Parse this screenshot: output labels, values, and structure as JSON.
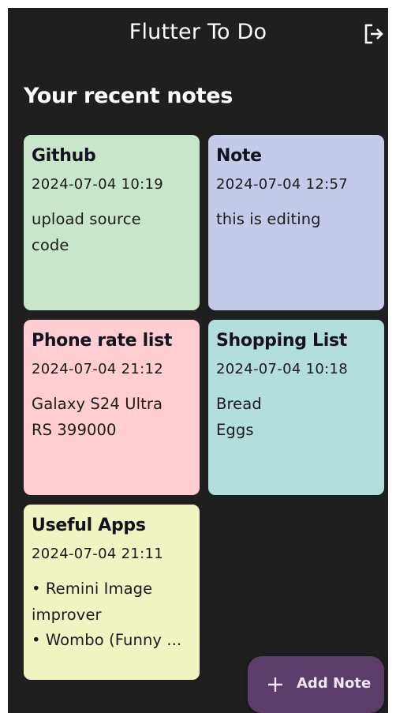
{
  "appbar": {
    "title": "Flutter To Do",
    "logout_icon": "logout-icon"
  },
  "section": {
    "title": "Your recent notes"
  },
  "notes": [
    {
      "title": "Github",
      "date": "2024-07-04 10:19",
      "lines": [
        "upload source",
        "code"
      ],
      "color": "#c8e6c9"
    },
    {
      "title": "Note",
      "date": "2024-07-04 12:57",
      "lines": [
        "this is editing"
      ],
      "color": "#c5cae9"
    },
    {
      "title": "Phone rate list",
      "date": "2024-07-04 21:12",
      "lines": [
        "Galaxy S24 Ultra",
        "RS 399000"
      ],
      "color": "#ffcdd2"
    },
    {
      "title": "Shopping List",
      "date": "2024-07-04 10:18",
      "lines": [
        "Bread",
        "Eggs"
      ],
      "color": "#b2dfdb"
    },
    {
      "title": "Useful Apps",
      "date": "2024-07-04 21:11",
      "lines": [
        "• Remini Image",
        "improver",
        "• Wombo (Funny ..."
      ],
      "color": "#f0f4c3"
    }
  ],
  "fab": {
    "label": "Add Note",
    "icon": "plus-icon"
  },
  "colors": {
    "background": "#1f1f1f",
    "fab": "#5c3c69"
  }
}
